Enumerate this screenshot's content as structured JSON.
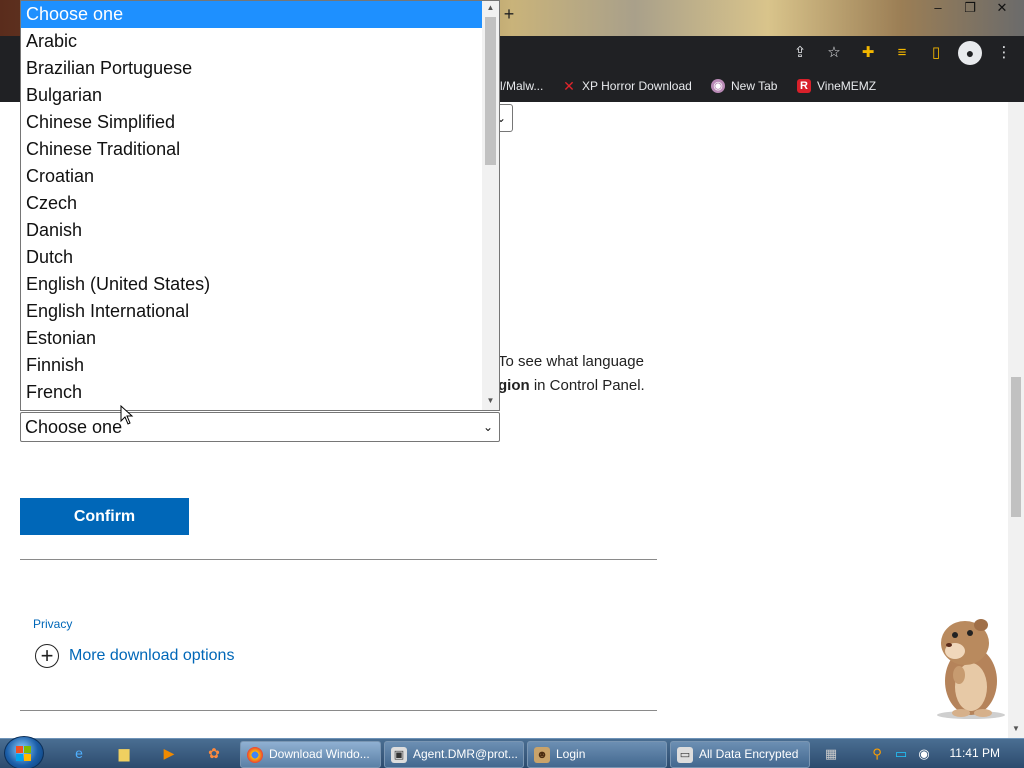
{
  "browser": {
    "bookmarks": [
      {
        "label": "l/Malw..."
      },
      {
        "label": "XP Horror Download",
        "icon": "x-icon"
      },
      {
        "label": "New Tab",
        "icon": "globe-icon"
      },
      {
        "label": "VineMEMZ",
        "icon": "r-icon"
      }
    ]
  },
  "page": {
    "info_line1": "To see what language",
    "info_line2_bold": "gion",
    "info_line2_rest": " in Control Panel.",
    "select_value": "Choose one",
    "confirm_label": "Confirm",
    "privacy_label": "Privacy",
    "more_download_label": "More download options"
  },
  "dropdown": {
    "selected": "Choose one",
    "options": [
      "Choose one",
      "Arabic",
      "Brazilian Portuguese",
      "Bulgarian",
      "Chinese Simplified",
      "Chinese Traditional",
      "Croatian",
      "Czech",
      "Danish",
      "Dutch",
      "English (United States)",
      "English International",
      "Estonian",
      "Finnish",
      "French"
    ]
  },
  "taskbar": {
    "tasks": [
      {
        "label": "Download Windo...",
        "icon": "chrome-icon"
      },
      {
        "label": "Agent.DMR@prot...",
        "icon": "window-icon"
      },
      {
        "label": "Login",
        "icon": "user-icon"
      },
      {
        "label": "All Data Encrypted",
        "icon": "window-icon"
      }
    ],
    "clock": "11:41 PM"
  },
  "colors": {
    "accent": "#0067b8",
    "selection": "#1e90ff",
    "chrome_dark": "#202124"
  }
}
